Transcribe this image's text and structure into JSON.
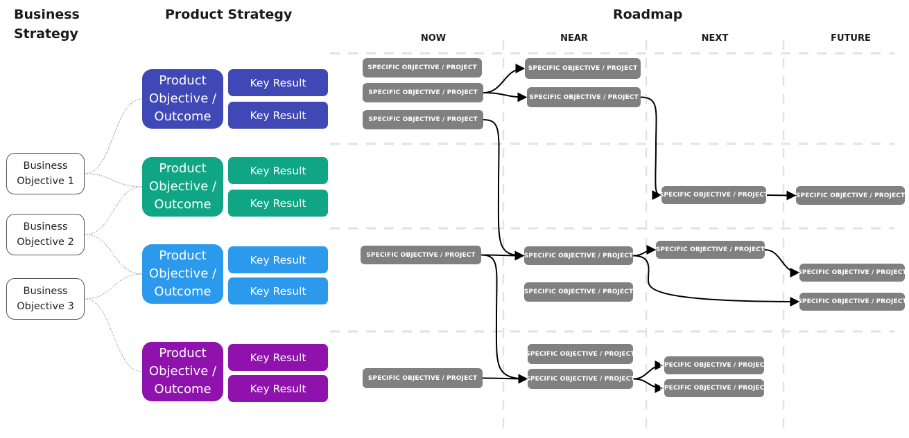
{
  "headings": {
    "business_strategy": "Business Strategy",
    "product_strategy": "Product Strategy",
    "roadmap": "Roadmap"
  },
  "roadmap_columns": [
    "NOW",
    "NEAR",
    "NEXT",
    "FUTURE"
  ],
  "business_objectives": [
    {
      "label": "Business Objective 1",
      "links_to": [
        0,
        1
      ]
    },
    {
      "label": "Business Objective 2",
      "links_to": [
        1,
        2
      ]
    },
    {
      "label": "Business Objective 3",
      "links_to": [
        2,
        3
      ]
    }
  ],
  "product_objectives": [
    {
      "label": "Product Objective / Outcome",
      "color": "#3f48b4",
      "key_results": [
        "Key Result",
        "Key Result"
      ]
    },
    {
      "label": "Product Objective / Outcome",
      "color": "#0fa585",
      "key_results": [
        "Key Result",
        "Key Result"
      ]
    },
    {
      "label": "Product Objective / Outcome",
      "color": "#2b99ec",
      "key_results": [
        "Key Result",
        "Key Result"
      ]
    },
    {
      "label": "Product Objective / Outcome",
      "color": "#9012ad",
      "key_results": [
        "Key Result",
        "Key Result"
      ]
    }
  ],
  "projects": [
    {
      "id": "p1",
      "column": "NOW",
      "lane": 1,
      "label": "SPECIFIC OBJECTIVE / PROJECT"
    },
    {
      "id": "p2",
      "column": "NOW",
      "lane": 1,
      "label": "SPECIFIC OBJECTIVE / PROJECT"
    },
    {
      "id": "p3",
      "column": "NOW",
      "lane": 1,
      "label": "SPECIFIC OBJECTIVE / PROJECT"
    },
    {
      "id": "p4",
      "column": "NEAR",
      "lane": 1,
      "label": "SPECIFIC OBJECTIVE / PROJECT"
    },
    {
      "id": "p5",
      "column": "NEAR",
      "lane": 1,
      "label": "SPECIFIC OBJECTIVE / PROJECT"
    },
    {
      "id": "p6",
      "column": "NEXT",
      "lane": 2,
      "label": "SPECIFIC OBJECTIVE / PROJECT"
    },
    {
      "id": "p7",
      "column": "FUTURE",
      "lane": 2,
      "label": "SPECIFIC OBJECTIVE / PROJECT"
    },
    {
      "id": "p8",
      "column": "NOW",
      "lane": 3,
      "label": "SPECIFIC OBJECTIVE / PROJECT"
    },
    {
      "id": "p9",
      "column": "NEAR",
      "lane": 3,
      "label": "SPECIFIC OBJECTIVE / PROJECT"
    },
    {
      "id": "p10",
      "column": "NEAR",
      "lane": 3,
      "label": "SPECIFIC OBJECTIVE / PROJECT"
    },
    {
      "id": "p11",
      "column": "NEXT",
      "lane": 3,
      "label": "SPECIFIC OBJECTIVE / PROJECT"
    },
    {
      "id": "p12",
      "column": "FUTURE",
      "lane": 3,
      "label": "SPECIFIC OBJECTIVE / PROJECT"
    },
    {
      "id": "p13",
      "column": "FUTURE",
      "lane": 3,
      "label": "SPECIFIC OBJECTIVE / PROJECT"
    },
    {
      "id": "p14",
      "column": "NEAR",
      "lane": 4,
      "label": "SPECIFIC OBJECTIVE / PROJECT"
    },
    {
      "id": "p15",
      "column": "NOW",
      "lane": 4,
      "label": "SPECIFIC OBJECTIVE / PROJECT"
    },
    {
      "id": "p16",
      "column": "NEAR",
      "lane": 4,
      "label": "SPECIFIC OBJECTIVE / PROJECT"
    },
    {
      "id": "p17",
      "column": "NEXT",
      "lane": 4,
      "label": "SPECIFIC OBJECTIVE / PROJECT"
    },
    {
      "id": "p18",
      "column": "NEXT",
      "lane": 4,
      "label": "SPECIFIC OBJECTIVE / PROJECT"
    }
  ],
  "dependencies": [
    [
      "p2",
      "p4"
    ],
    [
      "p2",
      "p5"
    ],
    [
      "p3",
      "p9"
    ],
    [
      "p5",
      "p6"
    ],
    [
      "p6",
      "p7"
    ],
    [
      "p8",
      "p9"
    ],
    [
      "p8",
      "p16"
    ],
    [
      "p9",
      "p11"
    ],
    [
      "p9",
      "p13"
    ],
    [
      "p11",
      "p12"
    ],
    [
      "p15",
      "p16"
    ],
    [
      "p16",
      "p17"
    ],
    [
      "p16",
      "p18"
    ]
  ]
}
